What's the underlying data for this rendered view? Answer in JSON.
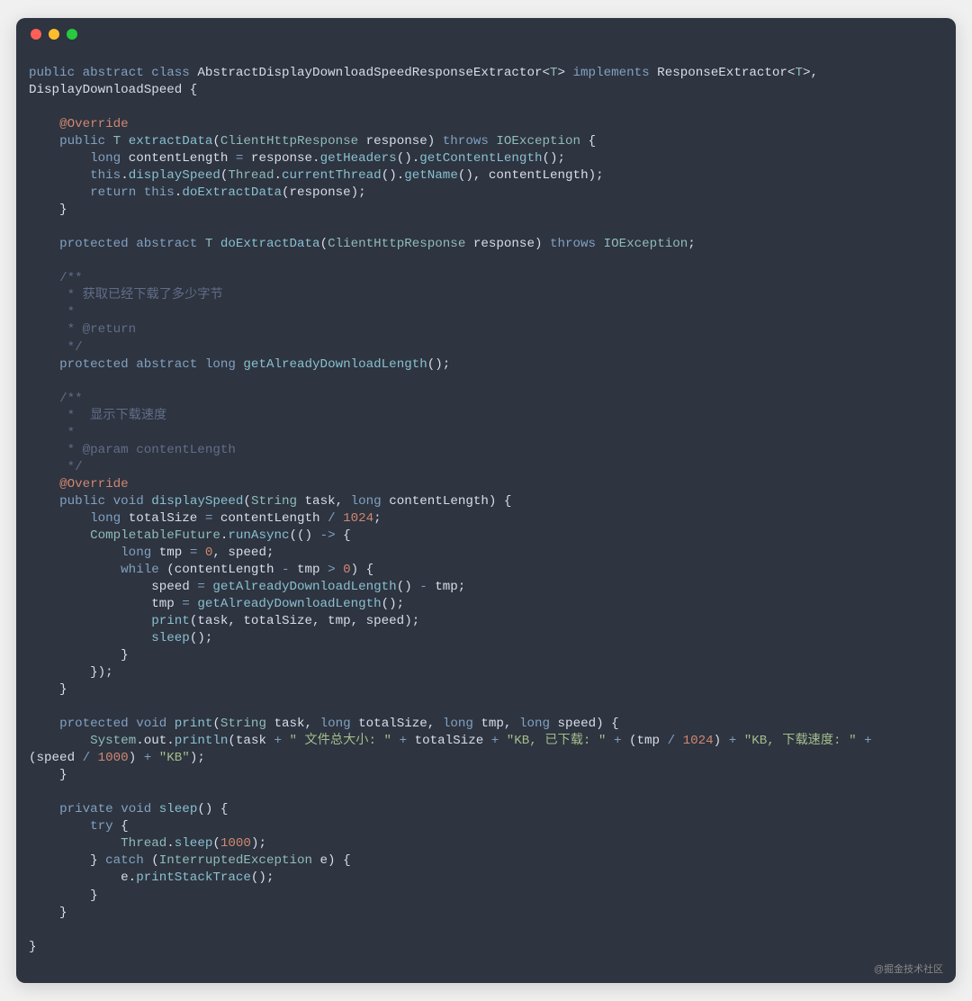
{
  "watermark": "@掘金技术社区",
  "code": {
    "tokens": [
      {
        "c": "kw",
        "t": "public"
      },
      {
        "c": "pln",
        "t": " "
      },
      {
        "c": "kw",
        "t": "abstract"
      },
      {
        "c": "pln",
        "t": " "
      },
      {
        "c": "kw",
        "t": "class"
      },
      {
        "c": "pln",
        "t": " AbstractDisplayDownloadSpeedResponseExtractor<"
      },
      {
        "c": "type",
        "t": "T"
      },
      {
        "c": "pln",
        "t": "> "
      },
      {
        "c": "kw",
        "t": "implements"
      },
      {
        "c": "pln",
        "t": " ResponseExtractor<"
      },
      {
        "c": "type",
        "t": "T"
      },
      {
        "c": "pln",
        "t": ">, \nDisplayDownloadSpeed {\n\n    "
      },
      {
        "c": "ann",
        "t": "@Override"
      },
      {
        "c": "pln",
        "t": "\n    "
      },
      {
        "c": "kw",
        "t": "public"
      },
      {
        "c": "pln",
        "t": " "
      },
      {
        "c": "type",
        "t": "T"
      },
      {
        "c": "pln",
        "t": " "
      },
      {
        "c": "fn",
        "t": "extractData"
      },
      {
        "c": "pln",
        "t": "("
      },
      {
        "c": "type",
        "t": "ClientHttpResponse"
      },
      {
        "c": "pln",
        "t": " response) "
      },
      {
        "c": "kw",
        "t": "throws"
      },
      {
        "c": "pln",
        "t": " "
      },
      {
        "c": "type",
        "t": "IOException"
      },
      {
        "c": "pln",
        "t": " {\n        "
      },
      {
        "c": "kw",
        "t": "long"
      },
      {
        "c": "pln",
        "t": " contentLength "
      },
      {
        "c": "op",
        "t": "="
      },
      {
        "c": "pln",
        "t": " response."
      },
      {
        "c": "fn",
        "t": "getHeaders"
      },
      {
        "c": "pln",
        "t": "()."
      },
      {
        "c": "fn",
        "t": "getContentLength"
      },
      {
        "c": "pln",
        "t": "();\n        "
      },
      {
        "c": "kw",
        "t": "this"
      },
      {
        "c": "pln",
        "t": "."
      },
      {
        "c": "fn",
        "t": "displaySpeed"
      },
      {
        "c": "pln",
        "t": "("
      },
      {
        "c": "type",
        "t": "Thread"
      },
      {
        "c": "pln",
        "t": "."
      },
      {
        "c": "fn",
        "t": "currentThread"
      },
      {
        "c": "pln",
        "t": "()."
      },
      {
        "c": "fn",
        "t": "getName"
      },
      {
        "c": "pln",
        "t": "(), contentLength);\n        "
      },
      {
        "c": "kw",
        "t": "return"
      },
      {
        "c": "pln",
        "t": " "
      },
      {
        "c": "kw",
        "t": "this"
      },
      {
        "c": "pln",
        "t": "."
      },
      {
        "c": "fn",
        "t": "doExtractData"
      },
      {
        "c": "pln",
        "t": "(response);\n    }\n\n    "
      },
      {
        "c": "kw",
        "t": "protected"
      },
      {
        "c": "pln",
        "t": " "
      },
      {
        "c": "kw",
        "t": "abstract"
      },
      {
        "c": "pln",
        "t": " "
      },
      {
        "c": "type",
        "t": "T"
      },
      {
        "c": "pln",
        "t": " "
      },
      {
        "c": "fn",
        "t": "doExtractData"
      },
      {
        "c": "pln",
        "t": "("
      },
      {
        "c": "type",
        "t": "ClientHttpResponse"
      },
      {
        "c": "pln",
        "t": " response) "
      },
      {
        "c": "kw",
        "t": "throws"
      },
      {
        "c": "pln",
        "t": " "
      },
      {
        "c": "type",
        "t": "IOException"
      },
      {
        "c": "pln",
        "t": ";\n\n    "
      },
      {
        "c": "com",
        "t": "/**\n     * 获取已经下载了多少字节\n     *\n     * @return\n     */"
      },
      {
        "c": "pln",
        "t": "\n    "
      },
      {
        "c": "kw",
        "t": "protected"
      },
      {
        "c": "pln",
        "t": " "
      },
      {
        "c": "kw",
        "t": "abstract"
      },
      {
        "c": "pln",
        "t": " "
      },
      {
        "c": "kw",
        "t": "long"
      },
      {
        "c": "pln",
        "t": " "
      },
      {
        "c": "fn",
        "t": "getAlreadyDownloadLength"
      },
      {
        "c": "pln",
        "t": "();\n\n    "
      },
      {
        "c": "com",
        "t": "/**\n     *  显示下载速度\n     *\n     * @param contentLength\n     */"
      },
      {
        "c": "pln",
        "t": "\n    "
      },
      {
        "c": "ann",
        "t": "@Override"
      },
      {
        "c": "pln",
        "t": "\n    "
      },
      {
        "c": "kw",
        "t": "public"
      },
      {
        "c": "pln",
        "t": " "
      },
      {
        "c": "kw",
        "t": "void"
      },
      {
        "c": "pln",
        "t": " "
      },
      {
        "c": "fn",
        "t": "displaySpeed"
      },
      {
        "c": "pln",
        "t": "("
      },
      {
        "c": "type",
        "t": "String"
      },
      {
        "c": "pln",
        "t": " task, "
      },
      {
        "c": "kw",
        "t": "long"
      },
      {
        "c": "pln",
        "t": " contentLength) {\n        "
      },
      {
        "c": "kw",
        "t": "long"
      },
      {
        "c": "pln",
        "t": " totalSize "
      },
      {
        "c": "op",
        "t": "="
      },
      {
        "c": "pln",
        "t": " contentLength "
      },
      {
        "c": "op",
        "t": "/"
      },
      {
        "c": "pln",
        "t": " "
      },
      {
        "c": "num",
        "t": "1024"
      },
      {
        "c": "pln",
        "t": ";\n        "
      },
      {
        "c": "type",
        "t": "CompletableFuture"
      },
      {
        "c": "pln",
        "t": "."
      },
      {
        "c": "fn",
        "t": "runAsync"
      },
      {
        "c": "pln",
        "t": "(() "
      },
      {
        "c": "op",
        "t": "->"
      },
      {
        "c": "pln",
        "t": " {\n            "
      },
      {
        "c": "kw",
        "t": "long"
      },
      {
        "c": "pln",
        "t": " tmp "
      },
      {
        "c": "op",
        "t": "="
      },
      {
        "c": "pln",
        "t": " "
      },
      {
        "c": "num",
        "t": "0"
      },
      {
        "c": "pln",
        "t": ", speed;\n            "
      },
      {
        "c": "kw",
        "t": "while"
      },
      {
        "c": "pln",
        "t": " (contentLength "
      },
      {
        "c": "op",
        "t": "-"
      },
      {
        "c": "pln",
        "t": " tmp "
      },
      {
        "c": "op",
        "t": ">"
      },
      {
        "c": "pln",
        "t": " "
      },
      {
        "c": "num",
        "t": "0"
      },
      {
        "c": "pln",
        "t": ") {\n                speed "
      },
      {
        "c": "op",
        "t": "="
      },
      {
        "c": "pln",
        "t": " "
      },
      {
        "c": "fn",
        "t": "getAlreadyDownloadLength"
      },
      {
        "c": "pln",
        "t": "() "
      },
      {
        "c": "op",
        "t": "-"
      },
      {
        "c": "pln",
        "t": " tmp;\n                tmp "
      },
      {
        "c": "op",
        "t": "="
      },
      {
        "c": "pln",
        "t": " "
      },
      {
        "c": "fn",
        "t": "getAlreadyDownloadLength"
      },
      {
        "c": "pln",
        "t": "();\n                "
      },
      {
        "c": "fn",
        "t": "print"
      },
      {
        "c": "pln",
        "t": "(task, totalSize, tmp, speed);\n                "
      },
      {
        "c": "fn",
        "t": "sleep"
      },
      {
        "c": "pln",
        "t": "();\n            }\n        });\n    }\n\n    "
      },
      {
        "c": "kw",
        "t": "protected"
      },
      {
        "c": "pln",
        "t": " "
      },
      {
        "c": "kw",
        "t": "void"
      },
      {
        "c": "pln",
        "t": " "
      },
      {
        "c": "fn",
        "t": "print"
      },
      {
        "c": "pln",
        "t": "("
      },
      {
        "c": "type",
        "t": "String"
      },
      {
        "c": "pln",
        "t": " task, "
      },
      {
        "c": "kw",
        "t": "long"
      },
      {
        "c": "pln",
        "t": " totalSize, "
      },
      {
        "c": "kw",
        "t": "long"
      },
      {
        "c": "pln",
        "t": " tmp, "
      },
      {
        "c": "kw",
        "t": "long"
      },
      {
        "c": "pln",
        "t": " speed) {\n        "
      },
      {
        "c": "type",
        "t": "System"
      },
      {
        "c": "pln",
        "t": ".out."
      },
      {
        "c": "fn",
        "t": "println"
      },
      {
        "c": "pln",
        "t": "(task "
      },
      {
        "c": "op",
        "t": "+"
      },
      {
        "c": "pln",
        "t": " "
      },
      {
        "c": "str",
        "t": "\" 文件总大小: \""
      },
      {
        "c": "pln",
        "t": " "
      },
      {
        "c": "op",
        "t": "+"
      },
      {
        "c": "pln",
        "t": " totalSize "
      },
      {
        "c": "op",
        "t": "+"
      },
      {
        "c": "pln",
        "t": " "
      },
      {
        "c": "str",
        "t": "\"KB, 已下载: \""
      },
      {
        "c": "pln",
        "t": " "
      },
      {
        "c": "op",
        "t": "+"
      },
      {
        "c": "pln",
        "t": " (tmp "
      },
      {
        "c": "op",
        "t": "/"
      },
      {
        "c": "pln",
        "t": " "
      },
      {
        "c": "num",
        "t": "1024"
      },
      {
        "c": "pln",
        "t": ") "
      },
      {
        "c": "op",
        "t": "+"
      },
      {
        "c": "pln",
        "t": " "
      },
      {
        "c": "str",
        "t": "\"KB, 下载速度: \""
      },
      {
        "c": "pln",
        "t": " "
      },
      {
        "c": "op",
        "t": "+"
      },
      {
        "c": "pln",
        "t": " \n(speed "
      },
      {
        "c": "op",
        "t": "/"
      },
      {
        "c": "pln",
        "t": " "
      },
      {
        "c": "num",
        "t": "1000"
      },
      {
        "c": "pln",
        "t": ") "
      },
      {
        "c": "op",
        "t": "+"
      },
      {
        "c": "pln",
        "t": " "
      },
      {
        "c": "str",
        "t": "\"KB\""
      },
      {
        "c": "pln",
        "t": ");\n    }\n\n    "
      },
      {
        "c": "kw",
        "t": "private"
      },
      {
        "c": "pln",
        "t": " "
      },
      {
        "c": "kw",
        "t": "void"
      },
      {
        "c": "pln",
        "t": " "
      },
      {
        "c": "fn",
        "t": "sleep"
      },
      {
        "c": "pln",
        "t": "() {\n        "
      },
      {
        "c": "kw",
        "t": "try"
      },
      {
        "c": "pln",
        "t": " {\n            "
      },
      {
        "c": "type",
        "t": "Thread"
      },
      {
        "c": "pln",
        "t": "."
      },
      {
        "c": "fn",
        "t": "sleep"
      },
      {
        "c": "pln",
        "t": "("
      },
      {
        "c": "num",
        "t": "1000"
      },
      {
        "c": "pln",
        "t": ");\n        } "
      },
      {
        "c": "kw",
        "t": "catch"
      },
      {
        "c": "pln",
        "t": " ("
      },
      {
        "c": "type",
        "t": "InterruptedException"
      },
      {
        "c": "pln",
        "t": " e) {\n            e."
      },
      {
        "c": "fn",
        "t": "printStackTrace"
      },
      {
        "c": "pln",
        "t": "();\n        }\n    }\n\n}"
      }
    ]
  }
}
